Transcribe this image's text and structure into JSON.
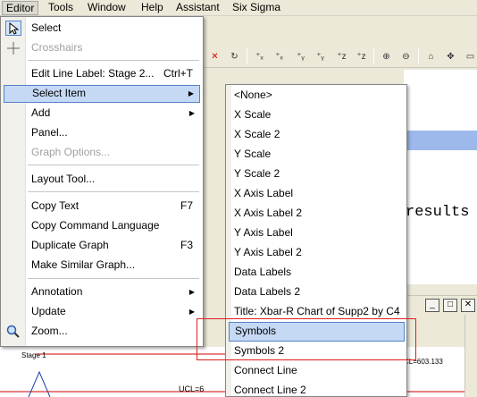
{
  "menubar": {
    "items": [
      "Editor",
      "Tools",
      "Window",
      "Help",
      "Assistant",
      "Six Sigma"
    ]
  },
  "editor_menu": {
    "items": [
      {
        "label": "Select",
        "shortcut": "",
        "icon": "cursor-arrow-icon",
        "disabled": false,
        "submenu": false
      },
      {
        "label": "Crosshairs",
        "shortcut": "",
        "icon": "crosshairs-icon",
        "disabled": true,
        "submenu": false
      },
      {
        "label": "Edit Line Label: Stage 2...",
        "shortcut": "Ctrl+T",
        "disabled": false,
        "submenu": false
      },
      {
        "label": "Select Item",
        "shortcut": "",
        "disabled": false,
        "submenu": true,
        "selected": true
      },
      {
        "label": "Add",
        "shortcut": "",
        "disabled": false,
        "submenu": true
      },
      {
        "label": "Panel...",
        "shortcut": "",
        "disabled": false,
        "submenu": false
      },
      {
        "label": "Graph Options...",
        "shortcut": "",
        "disabled": true,
        "submenu": false
      },
      {
        "label": "Layout Tool...",
        "shortcut": "",
        "disabled": false,
        "submenu": false
      },
      {
        "label": "Copy Text",
        "shortcut": "F7",
        "disabled": false,
        "submenu": false
      },
      {
        "label": "Copy Command Language",
        "shortcut": "",
        "disabled": false,
        "submenu": false
      },
      {
        "label": "Duplicate Graph",
        "shortcut": "F3",
        "disabled": false,
        "submenu": false
      },
      {
        "label": "Make Similar Graph...",
        "shortcut": "",
        "disabled": false,
        "submenu": false
      },
      {
        "label": "Annotation",
        "shortcut": "",
        "disabled": false,
        "submenu": true
      },
      {
        "label": "Update",
        "shortcut": "",
        "disabled": false,
        "submenu": true
      },
      {
        "label": "Zoom...",
        "shortcut": "",
        "icon": "magnifier-icon",
        "disabled": false,
        "submenu": false
      }
    ]
  },
  "select_item_submenu": {
    "items": [
      "<None>",
      "X Scale",
      "X Scale 2",
      "Y Scale",
      "Y Scale 2",
      "X Axis Label",
      "X Axis Label 2",
      "Y Axis Label",
      "Y Axis Label 2",
      "Data Labels",
      "Data Labels 2",
      "Title: Xbar-R Chart of Supp2 by C4",
      "Symbols",
      "Symbols 2",
      "Connect Line",
      "Connect Line 2"
    ],
    "selected": "Symbols"
  },
  "background": {
    "results_text": "results",
    "chart_title": "Stage 1",
    "ucl_left": "UCL=6",
    "ucl_right": "CL=603.133"
  },
  "colors": {
    "selection_bg": "#c5d9f5",
    "selection_border": "#5683c7",
    "highlight_box": "#e02020"
  }
}
